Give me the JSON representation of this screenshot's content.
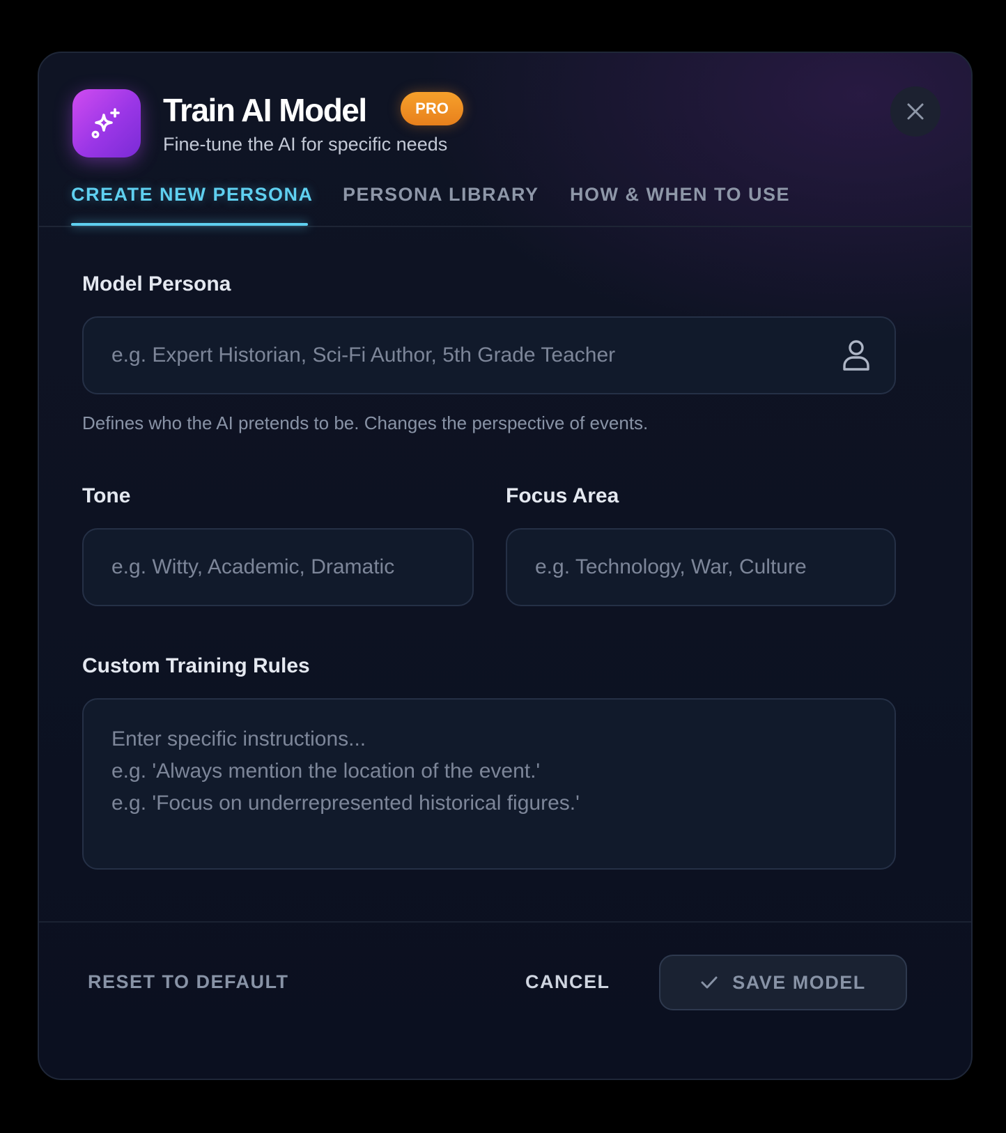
{
  "header": {
    "title": "Train AI Model",
    "badge": "PRO",
    "subtitle": "Fine-tune the AI for specific needs",
    "app_icon": "sparkles-icon",
    "close_icon": "close-icon"
  },
  "tabs": [
    {
      "label": "CREATE NEW PERSONA",
      "active": true
    },
    {
      "label": "PERSONA LIBRARY",
      "active": false
    },
    {
      "label": "HOW & WHEN TO USE",
      "active": false
    }
  ],
  "form": {
    "persona": {
      "label": "Model Persona",
      "value": "",
      "placeholder": "e.g. Expert Historian, Sci-Fi Author, 5th Grade Teacher",
      "icon": "person-icon",
      "helper": "Defines who the AI pretends to be. Changes the perspective of events."
    },
    "tone": {
      "label": "Tone",
      "value": "",
      "placeholder": "e.g. Witty, Academic, Dramatic"
    },
    "focus": {
      "label": "Focus Area",
      "value": "",
      "placeholder": "e.g. Technology, War, Culture"
    },
    "rules": {
      "label": "Custom Training Rules",
      "value": "",
      "placeholder": "Enter specific instructions...\ne.g. 'Always mention the location of the event.'\ne.g. 'Focus on underrepresented historical figures.'"
    }
  },
  "footer": {
    "reset_label": "RESET TO DEFAULT",
    "cancel_label": "CANCEL",
    "save_label": "SAVE MODEL",
    "save_icon": "check-icon"
  },
  "colors": {
    "accent": "#5fd0f0",
    "badge": "#f0901f",
    "app_icon": "#b140ea",
    "background": "#0b1020"
  }
}
